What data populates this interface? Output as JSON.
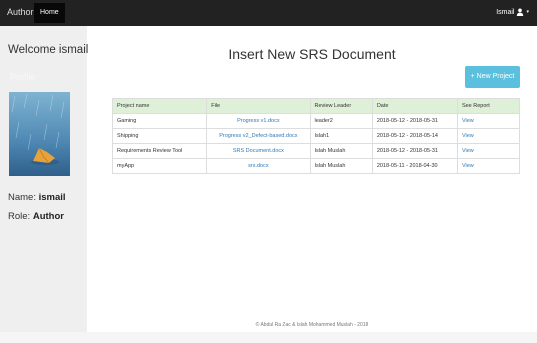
{
  "navbar": {
    "brand": "Author",
    "home_label": "Home",
    "user_label": "Ismail",
    "caret": "▾"
  },
  "sidebar": {
    "welcome": "Welcome ismail",
    "profile_label": "Profile",
    "name_label": "Name:",
    "name_value": "ismail",
    "role_label": "Role:",
    "role_value": "Author"
  },
  "main": {
    "title": "Insert New SRS Document",
    "new_project_label": "+ New Project",
    "table": {
      "headers": [
        "Project name",
        "File",
        "Review Leader",
        "Date",
        "See Report"
      ],
      "rows": [
        [
          "Gaming",
          "Progress v1.docx",
          "leader2",
          "2018-05-12 - 2018-05-31",
          "View"
        ],
        [
          "Shipping",
          "Progress v2_Defect-based.docx",
          "Islah1",
          "2018-05-12 - 2018-05-14",
          "View"
        ],
        [
          "Requirements Review Tool",
          "SRS Document.docx",
          "Islah Muslah",
          "2018-05-12 - 2018-05-31",
          "View"
        ],
        [
          "myApp",
          "srs.docx",
          "Islah Muslah",
          "2018-05-11 - 2018-04-30",
          "View"
        ]
      ]
    }
  },
  "footer": {
    "text": "© Abdul Ra Zac & Islah Mohammed Muslah - 2018"
  },
  "colors": {
    "navbar": "#222222",
    "table_header": "#dff0d8",
    "button": "#5bc0de",
    "link": "#337ab7"
  }
}
